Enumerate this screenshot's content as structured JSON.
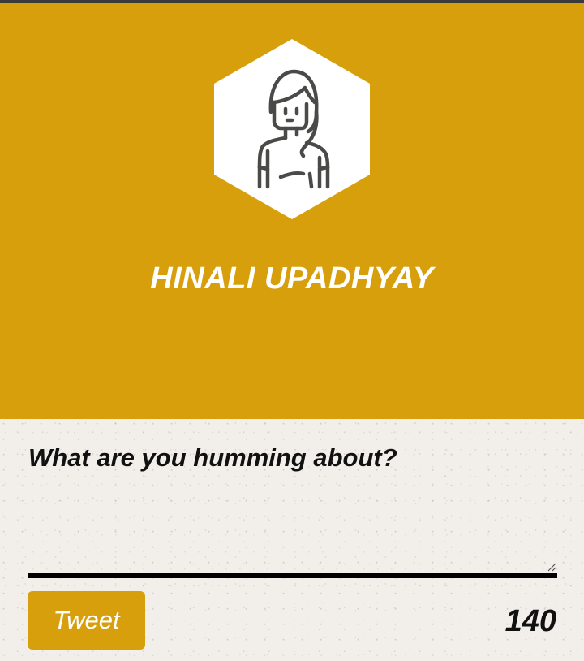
{
  "profile": {
    "name": "HINALI UPADHYAY",
    "avatar_icon": "woman-avatar-icon",
    "header_color": "#d89f0c"
  },
  "composer": {
    "prompt": "What are you humming about?",
    "text_value": "",
    "tweet_label": "Tweet",
    "char_count": "140",
    "accent_color": "#d89f0c"
  }
}
